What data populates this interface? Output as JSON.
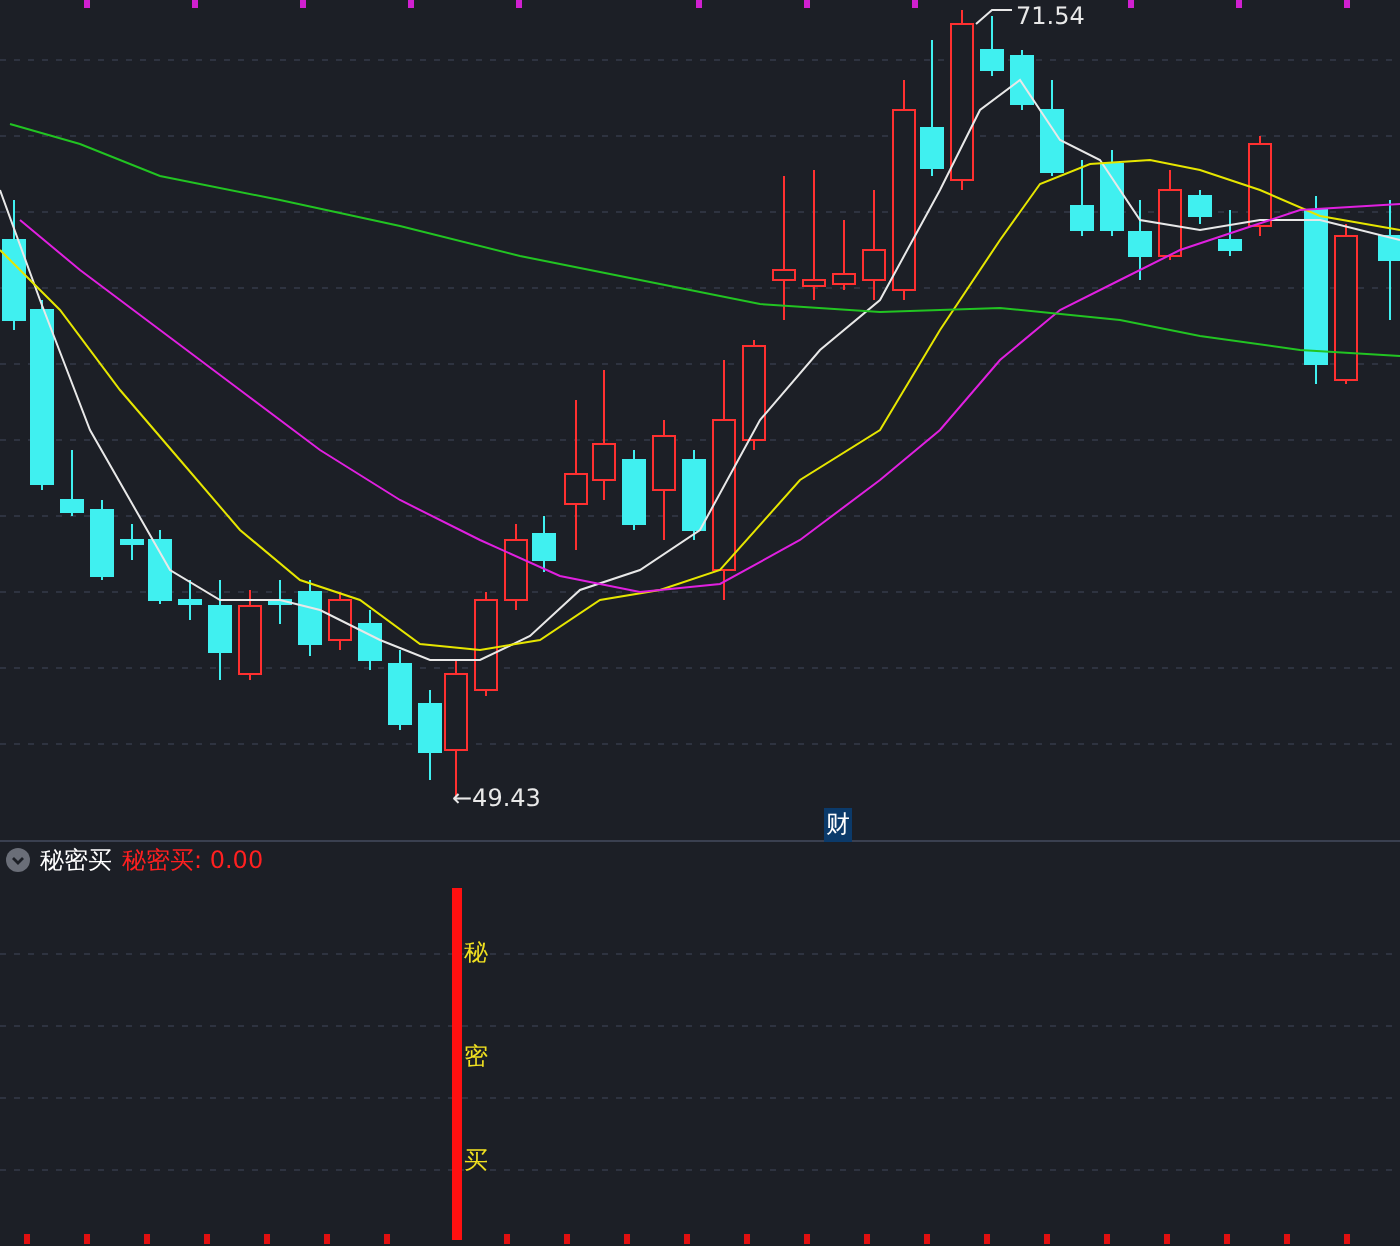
{
  "chart": {
    "high_label": "71.54",
    "low_label": "←49.43",
    "marker": "财"
  },
  "indicator": {
    "title": "秘密买",
    "reading": "秘密买: 0.00",
    "signal_chars": [
      "秘",
      "密",
      "买"
    ]
  }
}
